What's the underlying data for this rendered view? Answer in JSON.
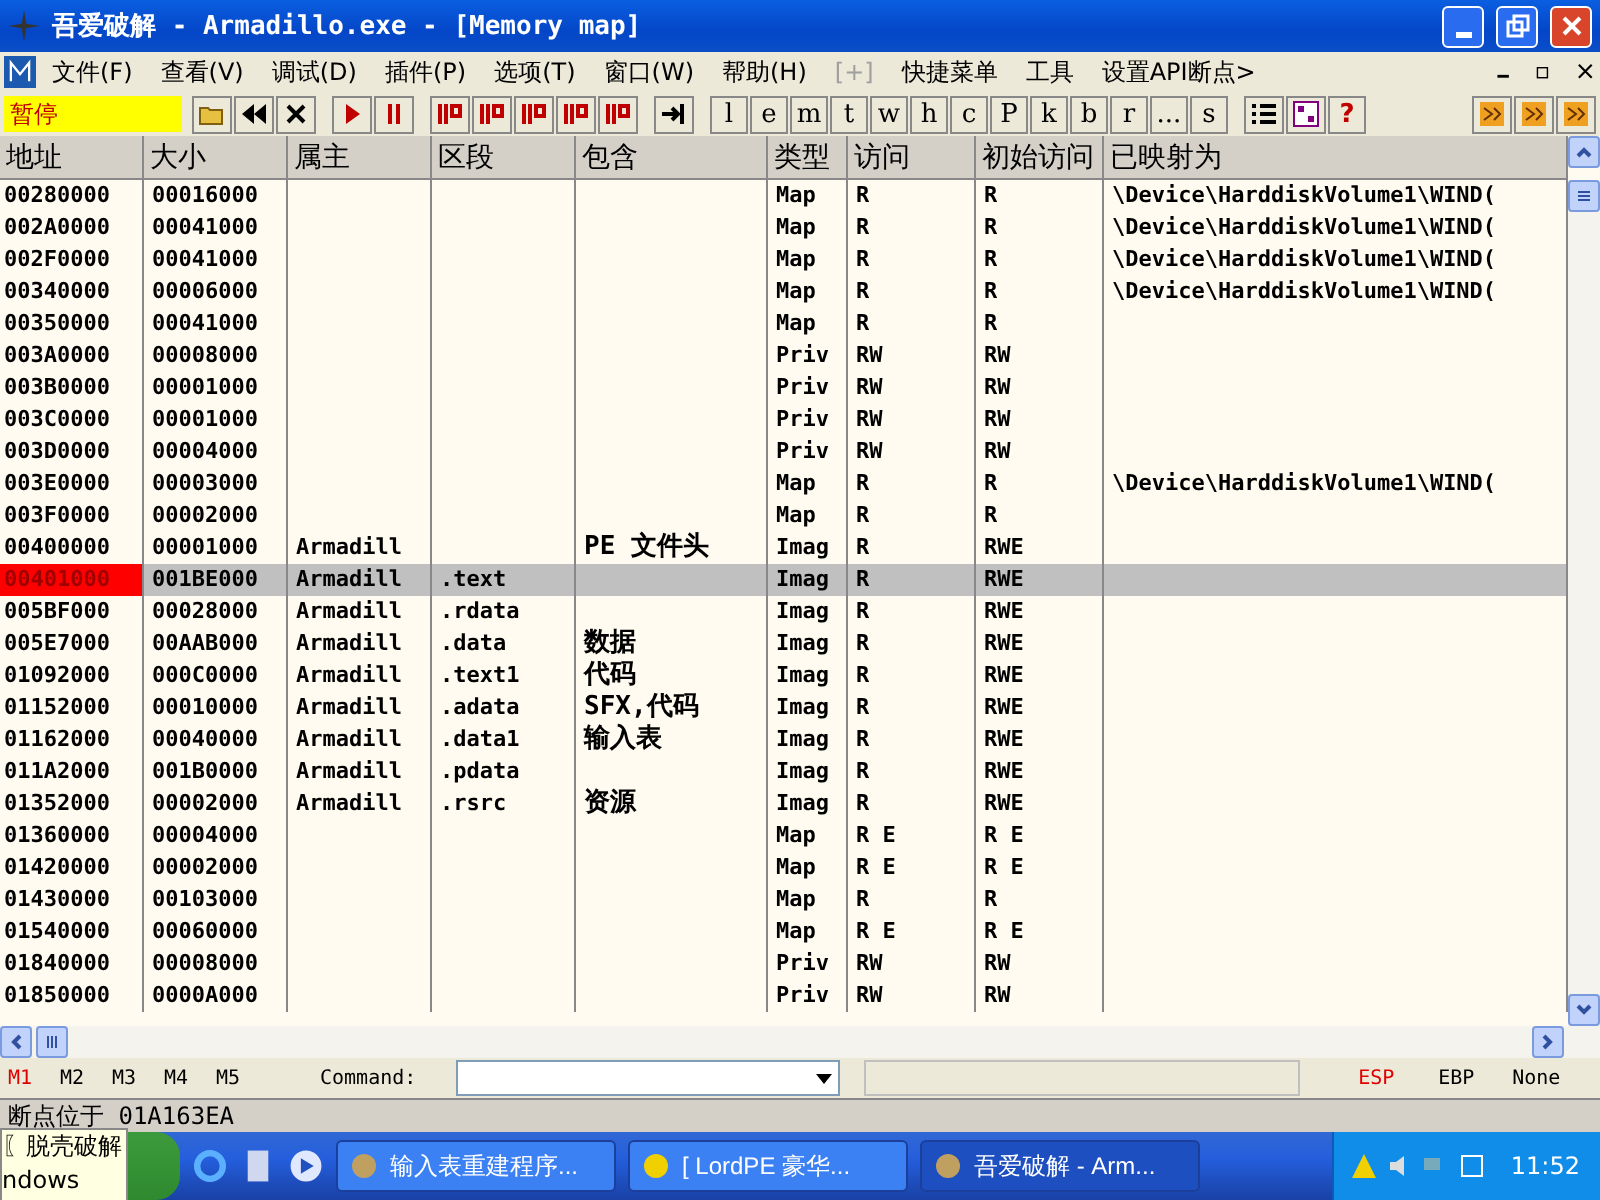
{
  "window": {
    "title": "吾爱破解 - Armadillo.exe - [Memory map]"
  },
  "menu": [
    {
      "label": "文件(F)",
      "disabled": false
    },
    {
      "label": "查看(V)",
      "disabled": false
    },
    {
      "label": "调试(D)",
      "disabled": false
    },
    {
      "label": "插件(P)",
      "disabled": false
    },
    {
      "label": "选项(T)",
      "disabled": false
    },
    {
      "label": "窗口(W)",
      "disabled": false
    },
    {
      "label": "帮助(H)",
      "disabled": false
    },
    {
      "label": "[+]",
      "disabled": true
    },
    {
      "label": "快捷菜单",
      "disabled": false
    },
    {
      "label": "工具",
      "disabled": false
    },
    {
      "label": "设置API断点>",
      "disabled": false
    }
  ],
  "status_label": "暂停",
  "toolbar": [
    {
      "kind": "open"
    },
    {
      "kind": "rewind"
    },
    {
      "kind": "close"
    },
    {
      "kind": "gap"
    },
    {
      "kind": "run"
    },
    {
      "kind": "pause"
    },
    {
      "kind": "gap"
    },
    {
      "kind": "step"
    },
    {
      "kind": "step"
    },
    {
      "kind": "step"
    },
    {
      "kind": "step"
    },
    {
      "kind": "step"
    },
    {
      "kind": "gap"
    },
    {
      "kind": "goto"
    },
    {
      "kind": "gap"
    },
    {
      "kind": "letter",
      "label": "l"
    },
    {
      "kind": "letter",
      "label": "e"
    },
    {
      "kind": "letter",
      "label": "m"
    },
    {
      "kind": "letter",
      "label": "t"
    },
    {
      "kind": "letter",
      "label": "w"
    },
    {
      "kind": "letter",
      "label": "h"
    },
    {
      "kind": "letter",
      "label": "c"
    },
    {
      "kind": "letter",
      "label": "P"
    },
    {
      "kind": "letter",
      "label": "k"
    },
    {
      "kind": "letter",
      "label": "b"
    },
    {
      "kind": "letter",
      "label": "r"
    },
    {
      "kind": "letter",
      "label": "..."
    },
    {
      "kind": "letter",
      "label": "s"
    },
    {
      "kind": "gap"
    },
    {
      "kind": "list"
    },
    {
      "kind": "grid"
    },
    {
      "kind": "help",
      "label": "?"
    },
    {
      "kind": "spacer"
    },
    {
      "kind": "plugin"
    },
    {
      "kind": "plugin"
    },
    {
      "kind": "plugin"
    }
  ],
  "table": {
    "columns": [
      "地址",
      "大小",
      "属主",
      "区段",
      "包含",
      "类型",
      "访问",
      "初始访问",
      "已映射为"
    ],
    "rows": [
      {
        "cells": [
          "00280000",
          "00016000",
          "",
          "",
          "",
          "Map",
          "R",
          "R",
          "\\Device\\HarddiskVolume1\\WIND("
        ],
        "selected": false,
        "highlight": false
      },
      {
        "cells": [
          "002A0000",
          "00041000",
          "",
          "",
          "",
          "Map",
          "R",
          "R",
          "\\Device\\HarddiskVolume1\\WIND("
        ],
        "selected": false,
        "highlight": false
      },
      {
        "cells": [
          "002F0000",
          "00041000",
          "",
          "",
          "",
          "Map",
          "R",
          "R",
          "\\Device\\HarddiskVolume1\\WIND("
        ],
        "selected": false,
        "highlight": false
      },
      {
        "cells": [
          "00340000",
          "00006000",
          "",
          "",
          "",
          "Map",
          "R",
          "R",
          "\\Device\\HarddiskVolume1\\WIND("
        ],
        "selected": false,
        "highlight": false
      },
      {
        "cells": [
          "00350000",
          "00041000",
          "",
          "",
          "",
          "Map",
          "R",
          "R",
          ""
        ],
        "selected": false,
        "highlight": false
      },
      {
        "cells": [
          "003A0000",
          "00008000",
          "",
          "",
          "",
          "Priv",
          "RW",
          "RW",
          ""
        ],
        "selected": false,
        "highlight": false
      },
      {
        "cells": [
          "003B0000",
          "00001000",
          "",
          "",
          "",
          "Priv",
          "RW",
          "RW",
          ""
        ],
        "selected": false,
        "highlight": false
      },
      {
        "cells": [
          "003C0000",
          "00001000",
          "",
          "",
          "",
          "Priv",
          "RW",
          "RW",
          ""
        ],
        "selected": false,
        "highlight": false
      },
      {
        "cells": [
          "003D0000",
          "00004000",
          "",
          "",
          "",
          "Priv",
          "RW",
          "RW",
          ""
        ],
        "selected": false,
        "highlight": false
      },
      {
        "cells": [
          "003E0000",
          "00003000",
          "",
          "",
          "",
          "Map",
          "R",
          "R",
          "\\Device\\HarddiskVolume1\\WIND("
        ],
        "selected": false,
        "highlight": false
      },
      {
        "cells": [
          "003F0000",
          "00002000",
          "",
          "",
          "",
          "Map",
          "R",
          "R",
          ""
        ],
        "selected": false,
        "highlight": false
      },
      {
        "cells": [
          "00400000",
          "00001000",
          "Armadill",
          "",
          "PE 文件头",
          "Imag",
          "R",
          "RWE",
          ""
        ],
        "selected": false,
        "highlight": false
      },
      {
        "cells": [
          "00401000",
          "001BE000",
          "Armadill",
          ".text",
          "",
          "Imag",
          "R",
          "RWE",
          ""
        ],
        "selected": true,
        "highlight": true
      },
      {
        "cells": [
          "005BF000",
          "00028000",
          "Armadill",
          ".rdata",
          "",
          "Imag",
          "R",
          "RWE",
          ""
        ],
        "selected": false,
        "highlight": false
      },
      {
        "cells": [
          "005E7000",
          "00AAB000",
          "Armadill",
          ".data",
          "数据",
          "Imag",
          "R",
          "RWE",
          ""
        ],
        "selected": false,
        "highlight": false
      },
      {
        "cells": [
          "01092000",
          "000C0000",
          "Armadill",
          ".text1",
          "代码",
          "Imag",
          "R",
          "RWE",
          ""
        ],
        "selected": false,
        "highlight": false
      },
      {
        "cells": [
          "01152000",
          "00010000",
          "Armadill",
          ".adata",
          "SFX,代码",
          "Imag",
          "R",
          "RWE",
          ""
        ],
        "selected": false,
        "highlight": false
      },
      {
        "cells": [
          "01162000",
          "00040000",
          "Armadill",
          ".data1",
          "输入表",
          "Imag",
          "R",
          "RWE",
          ""
        ],
        "selected": false,
        "highlight": false
      },
      {
        "cells": [
          "011A2000",
          "001B0000",
          "Armadill",
          ".pdata",
          "",
          "Imag",
          "R",
          "RWE",
          ""
        ],
        "selected": false,
        "highlight": false
      },
      {
        "cells": [
          "01352000",
          "00002000",
          "Armadill",
          ".rsrc",
          "资源",
          "Imag",
          "R",
          "RWE",
          ""
        ],
        "selected": false,
        "highlight": false
      },
      {
        "cells": [
          "01360000",
          "00004000",
          "",
          "",
          "",
          "Map",
          "R E",
          "R E",
          ""
        ],
        "selected": false,
        "highlight": false
      },
      {
        "cells": [
          "01420000",
          "00002000",
          "",
          "",
          "",
          "Map",
          "R E",
          "R E",
          ""
        ],
        "selected": false,
        "highlight": false
      },
      {
        "cells": [
          "01430000",
          "00103000",
          "",
          "",
          "",
          "Map",
          "R",
          "R",
          ""
        ],
        "selected": false,
        "highlight": false
      },
      {
        "cells": [
          "01540000",
          "00060000",
          "",
          "",
          "",
          "Map",
          "R E",
          "R E",
          ""
        ],
        "selected": false,
        "highlight": false
      },
      {
        "cells": [
          "01840000",
          "00008000",
          "",
          "",
          "",
          "Priv",
          "RW",
          "RW",
          ""
        ],
        "selected": false,
        "highlight": false
      },
      {
        "cells": [
          "01850000",
          "0000A000",
          "",
          "",
          "",
          "Priv",
          "RW",
          "RW",
          ""
        ],
        "selected": false,
        "highlight": false
      }
    ]
  },
  "memory_tabs": [
    {
      "label": "M1",
      "selected": true
    },
    {
      "label": "M2",
      "selected": false
    },
    {
      "label": "M3",
      "selected": false
    },
    {
      "label": "M4",
      "selected": false
    },
    {
      "label": "M5",
      "selected": false
    }
  ],
  "command": {
    "label": "Command:"
  },
  "registers": [
    {
      "label": "ESP",
      "selected": true
    },
    {
      "label": "EBP",
      "selected": false
    },
    {
      "label": "None",
      "selected": false
    }
  ],
  "status_bar": {
    "text": "断点位于 01A163EA"
  },
  "tooltip": {
    "lines": [
      "〖脱壳破解",
      "ndows"
    ]
  },
  "taskbar": {
    "tasks": [
      {
        "label": "输入表重建程序...",
        "active": false
      },
      {
        "label": "[ LordPE 豪华...",
        "active": false
      },
      {
        "label": "吾爱破解 - Arm...",
        "active": true
      }
    ],
    "clock": "11:52"
  }
}
